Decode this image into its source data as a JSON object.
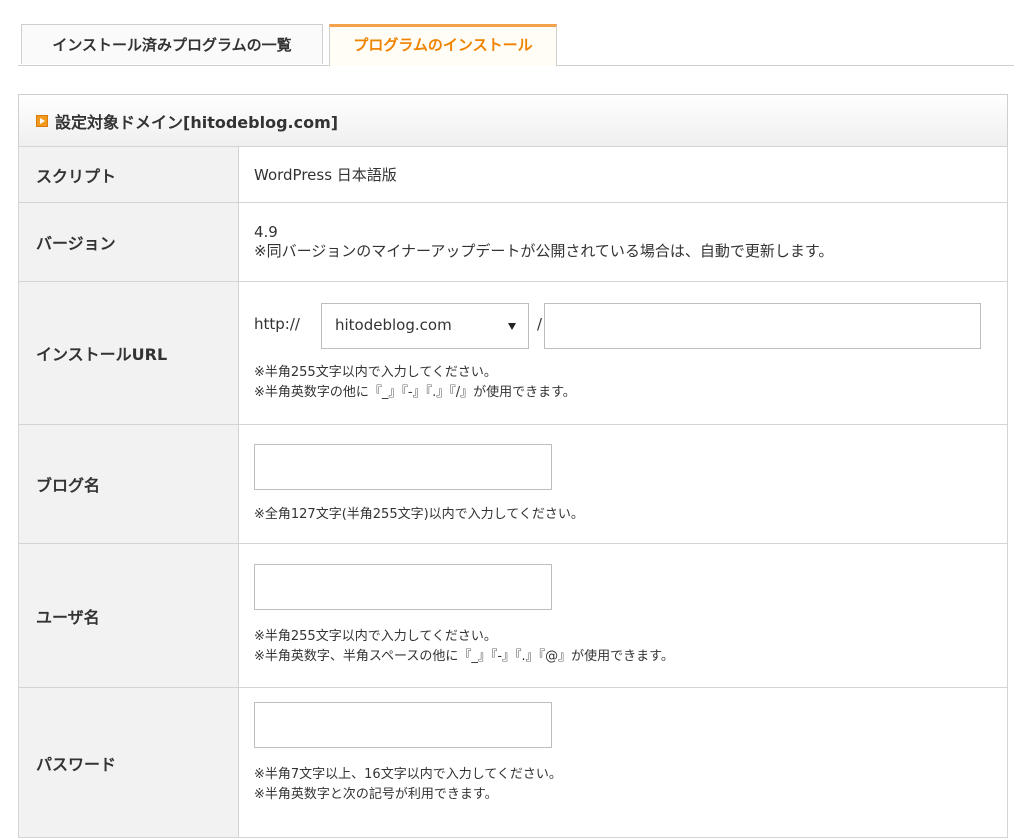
{
  "tabs": [
    {
      "label": "インストール済みプログラムの一覧"
    },
    {
      "label": "プログラムのインストール"
    }
  ],
  "section": {
    "title": "設定対象ドメイン[hitodeblog.com]"
  },
  "rows": {
    "script": {
      "label": "スクリプト",
      "value": "WordPress 日本語版"
    },
    "version": {
      "label": "バージョン",
      "value": "4.9",
      "note": "※同バージョンのマイナーアップデートが公開されている場合は、自動で更新します。"
    },
    "url": {
      "label": "インストールURL",
      "protocol": "http://",
      "domain_selected": "hitodeblog.com",
      "slash": "/",
      "path_value": "",
      "note1": "※半角255文字以内で入力してください。",
      "note2": "※半角英数字の他に『_』『-』『.』『/』が使用できます。"
    },
    "blogname": {
      "label": "ブログ名",
      "value": "",
      "note1": "※全角127文字(半角255文字)以内で入力してください。"
    },
    "username": {
      "label": "ユーザ名",
      "value": "",
      "note1": "※半角255文字以内で入力してください。",
      "note2": "※半角英数字、半角スペースの他に『_』『-』『.』『@』が使用できます。"
    },
    "password": {
      "label": "パスワード",
      "value": "",
      "note1": "※半角7文字以上、16文字以内で入力してください。",
      "note2": "※半角英数字と次の記号が利用できます。"
    }
  },
  "colors": {
    "accent": "#f08300",
    "header_bg": "#f2f2f2",
    "border": "#d4d4d4"
  }
}
